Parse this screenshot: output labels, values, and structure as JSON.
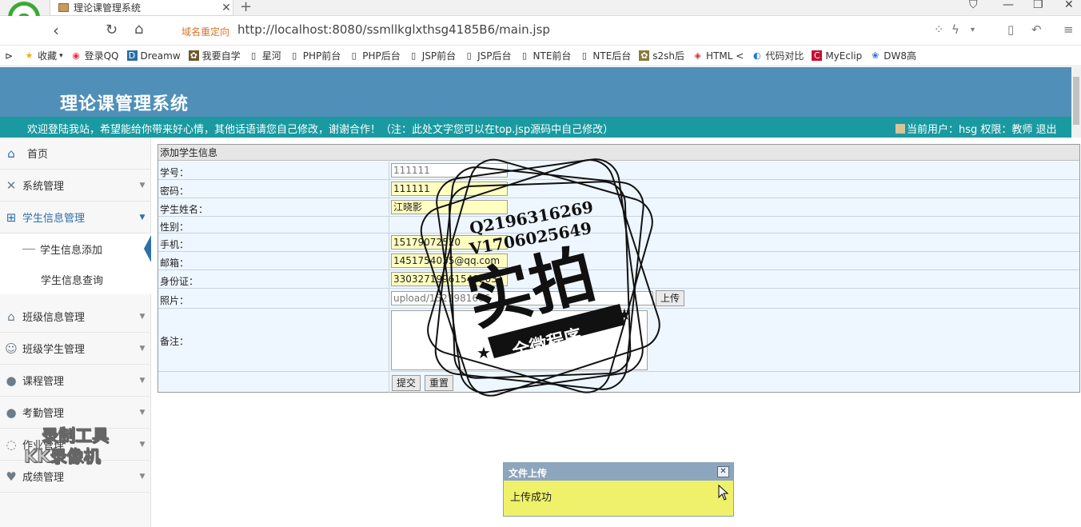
{
  "browser": {
    "tab_title": "理论课管理系统",
    "redirect_label": "域名重定向",
    "url": "http://localhost:8080/ssmllkglxthsg4185B6/main.jsp",
    "bookmarks": [
      {
        "label": "收藏",
        "icon": "star-icon"
      },
      {
        "label": "登录QQ",
        "icon": "qq-icon"
      },
      {
        "label": "Dreamw",
        "icon": "dreamweaver-icon"
      },
      {
        "label": "我要自学",
        "icon": "site-icon"
      },
      {
        "label": "星河",
        "icon": "page-icon"
      },
      {
        "label": "PHP前台",
        "icon": "page-icon"
      },
      {
        "label": "PHP后台",
        "icon": "page-icon"
      },
      {
        "label": "JSP前台",
        "icon": "page-icon"
      },
      {
        "label": "JSP后台",
        "icon": "page-icon"
      },
      {
        "label": "NTE前台",
        "icon": "page-icon"
      },
      {
        "label": "NTE后台",
        "icon": "page-icon"
      },
      {
        "label": "s2sh后",
        "icon": "site-icon"
      },
      {
        "label": "HTML <",
        "icon": "html-icon"
      },
      {
        "label": "代码对比",
        "icon": "compare-icon"
      },
      {
        "label": "MyEclip",
        "icon": "myeclipse-icon"
      },
      {
        "label": "DW8高",
        "icon": "paw-icon"
      }
    ]
  },
  "header": {
    "title": "理论课管理系统",
    "welcome": "欢迎登陆我站，希望能给你带来好心情，其他话语请您自己修改，谢谢合作！（注：此处文字您可以在top.jsp源码中自己修改）",
    "user_info": "当前用户：hsg 权限：教师 退出"
  },
  "sidebar": {
    "home": "首页",
    "items": [
      {
        "label": "系统管理",
        "icon": "wrench-icon"
      },
      {
        "label": "学生信息管理",
        "icon": "grid-icon"
      },
      {
        "label": "班级信息管理",
        "icon": "house-icon"
      },
      {
        "label": "班级学生管理",
        "icon": "users-icon"
      },
      {
        "label": "课程管理",
        "icon": "person-icon"
      },
      {
        "label": "考勤管理",
        "icon": "person-icon"
      },
      {
        "label": "作业管理",
        "icon": "chat-icon"
      },
      {
        "label": "成绩管理",
        "icon": "heart-icon"
      }
    ],
    "sub_items": [
      "学生信息添加",
      "学生信息查询"
    ]
  },
  "form": {
    "title": "添加学生信息",
    "labels": {
      "student_no": "学号：",
      "password": "密码：",
      "name": "学生姓名：",
      "gender": "性别：",
      "phone": "手机：",
      "email": "邮箱：",
      "id_card": "身份证：",
      "photo": "照片：",
      "remark": "备注："
    },
    "values": {
      "student_no": "111111",
      "password": "111111",
      "name": "江晓影",
      "phone": "15179072520",
      "email": "1451754035@qq.com",
      "id_card": "330327199615482031",
      "photo": "upload/1521981666"
    },
    "upload_button": "上传",
    "submit_button": "提交",
    "reset_button": "重置"
  },
  "stamp": {
    "qq": "Q2196316269",
    "vx": "V1706025649",
    "main": "实拍",
    "ribbon": "全微程序"
  },
  "recorder_watermark": {
    "line1": "录制工具",
    "line2": "KK录像机"
  },
  "popup": {
    "title": "文件上传",
    "message": "上传成功"
  }
}
